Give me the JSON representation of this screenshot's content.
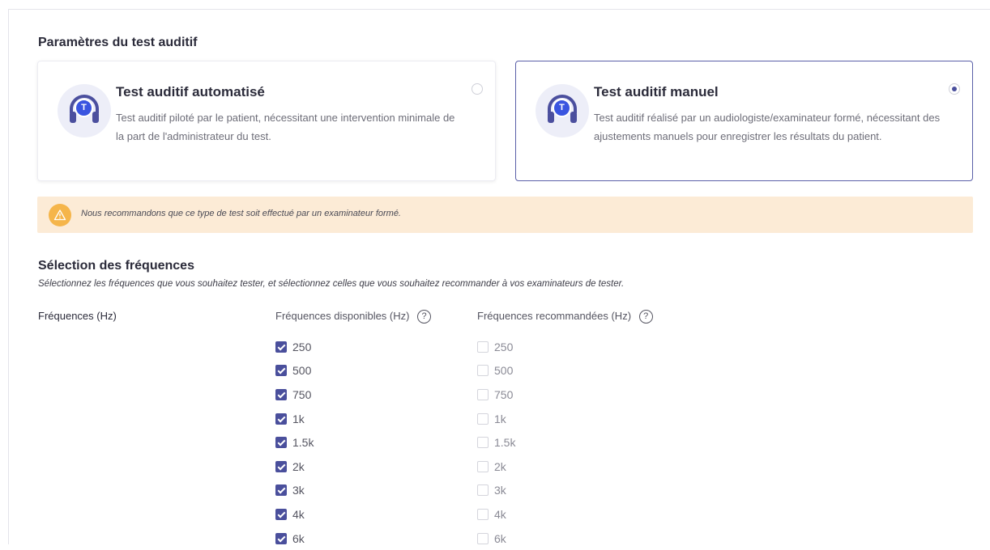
{
  "test_settings": {
    "title": "Paramètres du test auditif",
    "cards": [
      {
        "title": "Test auditif automatisé",
        "description": "Test auditif piloté par le patient, nécessitant une intervention minimale de la part de l'administrateur du test.",
        "badge": "T",
        "selected": false,
        "icon": "headphones-icon"
      },
      {
        "title": "Test auditif manuel",
        "description": "Test auditif réalisé par un audiologiste/examinateur formé, nécessitant des ajustements manuels pour enregistrer les résultats du patient.",
        "badge": "T",
        "selected": true,
        "icon": "headphones-icon"
      }
    ]
  },
  "warning": {
    "icon": "warning-triangle-icon",
    "text": "Nous recommandons que ce type de test soit effectué par un examinateur formé."
  },
  "frequency_selection": {
    "title": "Sélection des fréquences",
    "subtitle": "Sélectionnez les fréquences que vous souhaitez tester, et sélectionnez celles que vous souhaitez recommander à vos examinateurs de tester.",
    "field_label": "Fréquences (Hz)",
    "available_header": "Fréquences disponibles (Hz)",
    "recommended_header": "Fréquences recommandées (Hz)",
    "help_glyph": "?",
    "frequencies": [
      "250",
      "500",
      "750",
      "1k",
      "1.5k",
      "2k",
      "3k",
      "4k",
      "6k"
    ],
    "available_checked": [
      true,
      true,
      true,
      true,
      true,
      true,
      true,
      true,
      true
    ],
    "recommended_checked": [
      false,
      false,
      false,
      false,
      false,
      false,
      false,
      false,
      false
    ]
  },
  "colors": {
    "accent": "#4a4f9c",
    "badge": "#3a55e0",
    "warning_bg": "#fcebd6",
    "warning_icon": "#f5b54a"
  }
}
